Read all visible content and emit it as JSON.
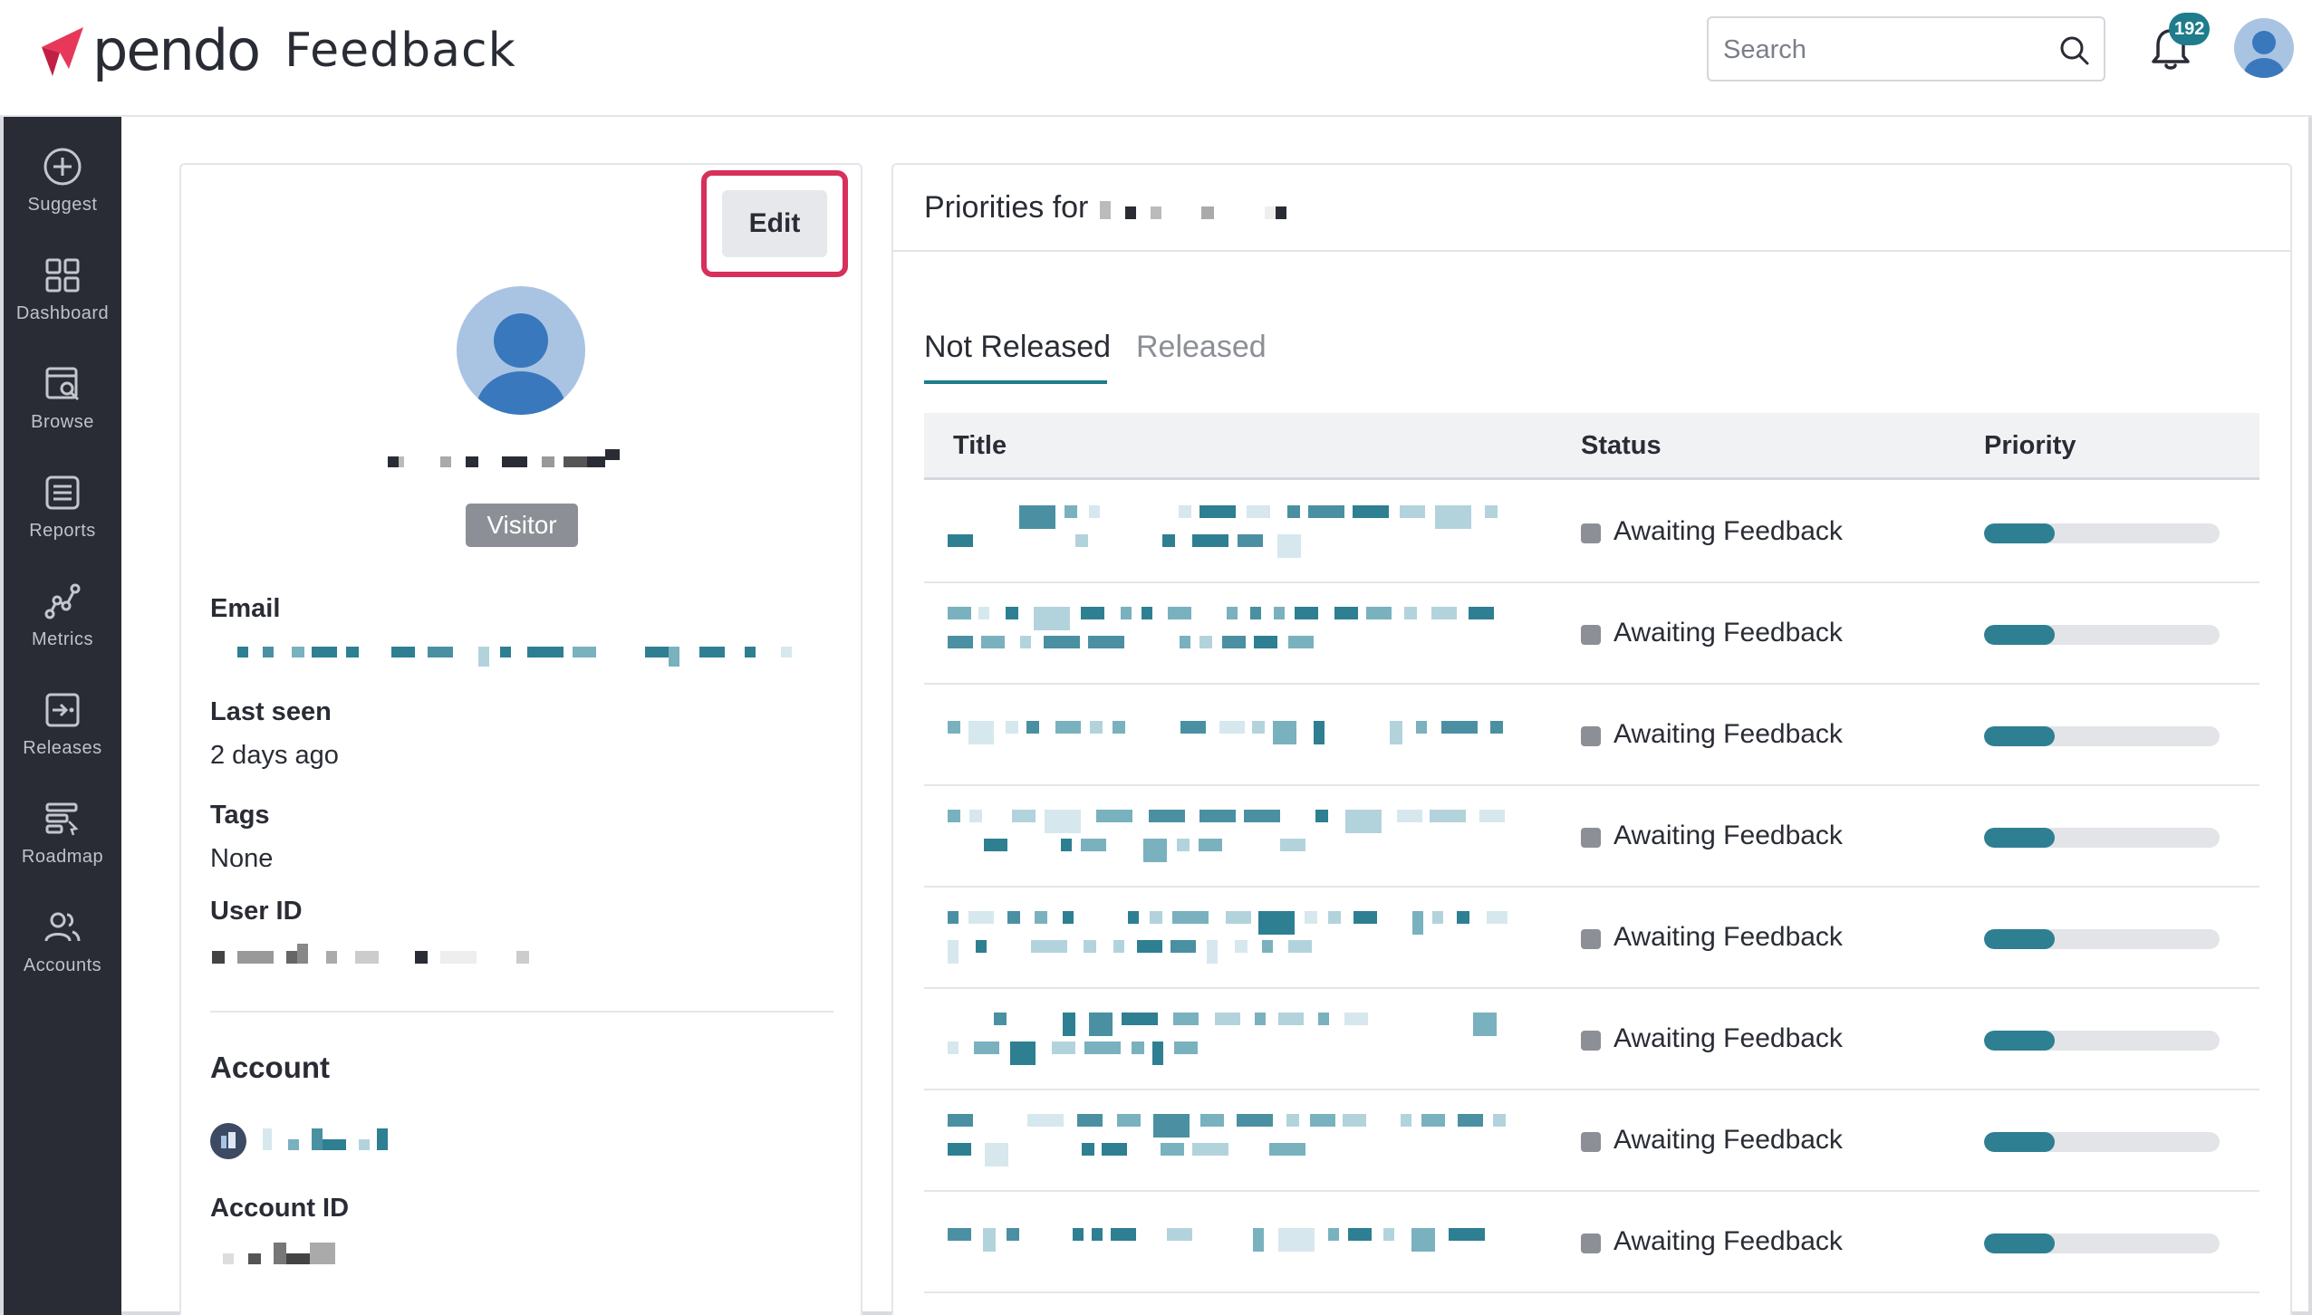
{
  "header": {
    "logo_text": "pendo",
    "app_name": "Feedback",
    "search_placeholder": "Search",
    "notification_count": "192"
  },
  "sidebar": {
    "items": [
      {
        "label": "Suggest",
        "icon": "plus-circle-icon"
      },
      {
        "label": "Dashboard",
        "icon": "grid-icon"
      },
      {
        "label": "Browse",
        "icon": "browse-icon"
      },
      {
        "label": "Reports",
        "icon": "reports-icon"
      },
      {
        "label": "Metrics",
        "icon": "metrics-icon"
      },
      {
        "label": "Releases",
        "icon": "releases-icon"
      },
      {
        "label": "Roadmap",
        "icon": "roadmap-icon"
      },
      {
        "label": "Accounts",
        "icon": "accounts-icon"
      }
    ]
  },
  "profile": {
    "edit_label": "Edit",
    "role_badge": "Visitor",
    "email_label": "Email",
    "last_seen_label": "Last seen",
    "last_seen_value": "2 days ago",
    "tags_label": "Tags",
    "tags_value": "None",
    "user_id_label": "User ID",
    "account_heading": "Account",
    "account_id_label": "Account ID"
  },
  "priorities": {
    "title_prefix": "Priorities for",
    "tabs": [
      "Not Released",
      "Released"
    ],
    "active_tab": "Not Released",
    "columns": [
      "Title",
      "Status",
      "Priority"
    ],
    "rows": [
      {
        "status": "Awaiting Feedback",
        "priority": 0.3
      },
      {
        "status": "Awaiting Feedback",
        "priority": 0.3
      },
      {
        "status": "Awaiting Feedback",
        "priority": 0.3
      },
      {
        "status": "Awaiting Feedback",
        "priority": 0.3
      },
      {
        "status": "Awaiting Feedback",
        "priority": 0.3
      },
      {
        "status": "Awaiting Feedback",
        "priority": 0.3
      },
      {
        "status": "Awaiting Feedback",
        "priority": 0.3
      },
      {
        "status": "Awaiting Feedback",
        "priority": 0.3
      }
    ]
  },
  "colors": {
    "brand_pink": "#e8385a",
    "accent_teal": "#1f7c8c",
    "highlight": "#d7305a",
    "sidebar_bg": "#2a2c35"
  }
}
